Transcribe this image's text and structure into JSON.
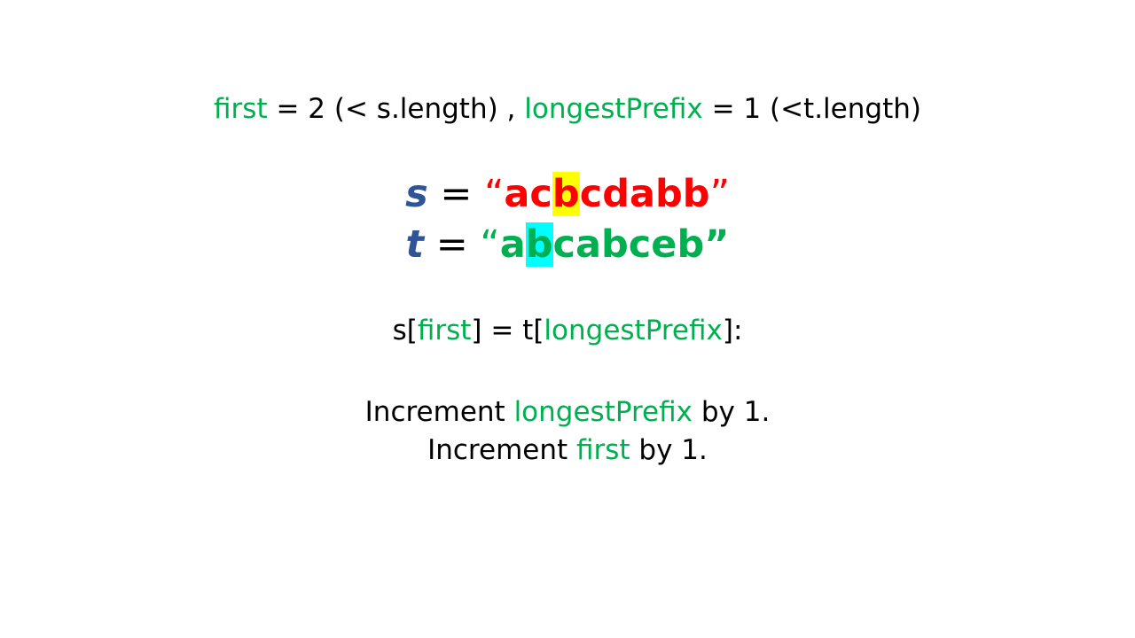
{
  "header": {
    "first_var": "first",
    "first_rest": " = 2 (< s.length) , ",
    "prefix_var": "longestPrefix",
    "prefix_rest": " = 1 (<t.length)"
  },
  "strings": {
    "s": {
      "name": "s",
      "eq": " = ",
      "open_quote": "“",
      "before": "ac",
      "highlight": "b",
      "after": "cdabb",
      "close_quote": "”"
    },
    "t": {
      "name": "t",
      "eq": " = ",
      "open_quote": "“",
      "before": "a",
      "highlight": "b",
      "after": "cabceb",
      "close_quote": "”"
    }
  },
  "condition": {
    "p1": "s[",
    "first": "first",
    "p2": "] = t[",
    "prefix": "longestPrefix",
    "p3": "]:"
  },
  "increments": [
    {
      "prefix": "Increment ",
      "var": "longestPrefix",
      "suffix": " by 1."
    },
    {
      "prefix": "Increment ",
      "var": "first",
      "suffix": " by 1."
    }
  ],
  "colors": {
    "variable_green": "#00b050",
    "variable_blue": "#2f5597",
    "string_red": "#ff0000",
    "string_green": "#00b050",
    "highlight_yellow": "#ffff00",
    "highlight_cyan": "#00ffff"
  }
}
